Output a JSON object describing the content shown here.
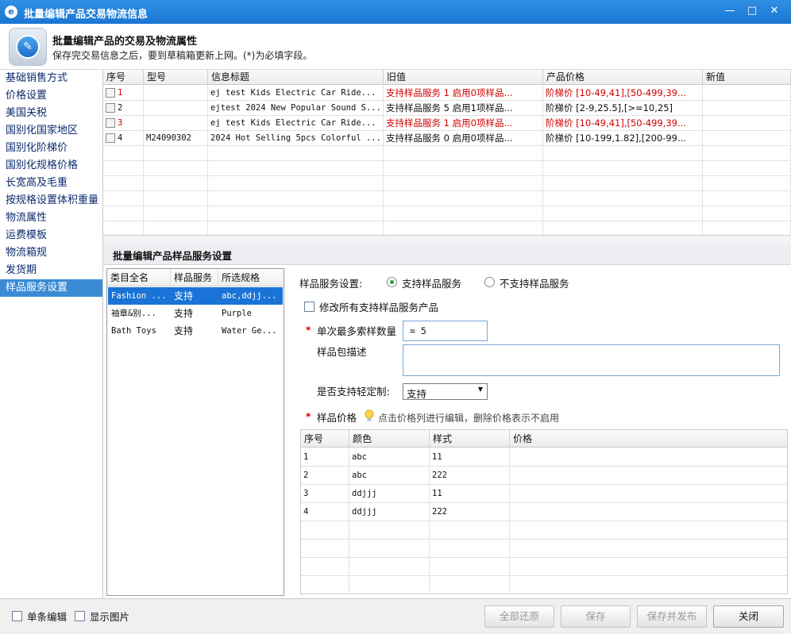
{
  "window": {
    "title": "批量编辑产品交易物流信息",
    "app_icon": "app-logo-icon",
    "minimize": "—",
    "maximize": "□",
    "close": "✕"
  },
  "header": {
    "title": "批量编辑产品的交易及物流属性",
    "subtitle": "保存完交易信息之后，要到草稿箱更新上网。(*)为必填字段。"
  },
  "sidebar": {
    "items": [
      {
        "label": "基础销售方式"
      },
      {
        "label": "价格设置"
      },
      {
        "label": "美国关税"
      },
      {
        "label": "国别化国家地区"
      },
      {
        "label": "国别化阶梯价"
      },
      {
        "label": "国别化规格价格"
      },
      {
        "label": "长宽高及毛重"
      },
      {
        "label": "按规格设置体积重量"
      },
      {
        "label": "物流属性"
      },
      {
        "label": "运费模板"
      },
      {
        "label": "物流箱规"
      },
      {
        "label": "发货期"
      },
      {
        "label": "样品服务设置"
      }
    ],
    "active_index": 12
  },
  "product_grid": {
    "columns": [
      "序号",
      "型号",
      "信息标题",
      "旧值",
      "产品价格",
      "新值"
    ],
    "rows": [
      {
        "no": "1",
        "model": "",
        "title": "ej test  Kids Electric Car Ride...",
        "old_value": "支持样品服务 1  启用0项样品...",
        "price": "阶梯价 [10-49,41],[50-499,39...",
        "new_value": "",
        "highlight": true
      },
      {
        "no": "2",
        "model": "",
        "title": "ejtest 2024 New Popular Sound S...",
        "old_value": "支持样品服务 5  启用1项样品...",
        "price": "阶梯价 [2-9,25.5],[>=10,25]",
        "new_value": "",
        "highlight": false
      },
      {
        "no": "3",
        "model": "",
        "title": "ej test  Kids Electric Car Ride...",
        "old_value": "支持样品服务 1  启用0项样品...",
        "price": "阶梯价 [10-49,41],[50-499,39...",
        "new_value": "",
        "highlight": true
      },
      {
        "no": "4",
        "model": "M24090302",
        "title": "2024 Hot Selling 5pcs Colorful ...",
        "old_value": "支持样品服务 0  启用0项样品...",
        "price": "阶梯价 [10-199,1.82],[200-99...",
        "new_value": "",
        "highlight": false
      }
    ]
  },
  "section": {
    "title": "批量编辑产品样品服务设置"
  },
  "category_list": {
    "columns": [
      "类目全名",
      "样品服务",
      "所选规格"
    ],
    "rows": [
      {
        "name": "Fashion ...",
        "service": "支持",
        "spec": "abc,ddjj..."
      },
      {
        "name": "袖章&别...",
        "service": "支持",
        "spec": "Purple"
      },
      {
        "name": "Bath Toys",
        "service": "支持",
        "spec": "Water Ge..."
      }
    ],
    "selected_index": 0
  },
  "form": {
    "service_label": "样品服务设置:",
    "radio_support": "支持样品服务",
    "radio_not_support": "不支持样品服务",
    "radio_selected": "support",
    "modify_all_label": "修改所有支持样品服务产品",
    "max_qty_label": "单次最多索样数量",
    "max_qty_value": "=  5",
    "package_desc_label": "样品包描述",
    "package_desc_value": "",
    "customize_label": "是否支持轻定制:",
    "customize_value": "支持",
    "price_label": "样品价格",
    "price_tip": "点击价格列进行编辑，删除价格表示不启用",
    "required_mark": "*"
  },
  "price_grid": {
    "columns": [
      "序号",
      "颜色",
      "样式",
      "价格"
    ],
    "rows": [
      {
        "no": "1",
        "color": "abc",
        "style": "11",
        "price": ""
      },
      {
        "no": "2",
        "color": "abc",
        "style": "222",
        "price": ""
      },
      {
        "no": "3",
        "color": "ddjjj",
        "style": "11",
        "price": ""
      },
      {
        "no": "4",
        "color": "ddjjj",
        "style": "222",
        "price": ""
      }
    ]
  },
  "footer": {
    "single_edit": "单条编辑",
    "show_image": "显示图片",
    "restore_all": "全部还原",
    "save": "保存",
    "save_publish": "保存并发布",
    "close": "关闭"
  },
  "colors": {
    "titlebar": "#1a76d2",
    "sidebar_active": "#3b8bd4",
    "highlight_red": "#d00000",
    "radio_on": "#2aa33a"
  }
}
